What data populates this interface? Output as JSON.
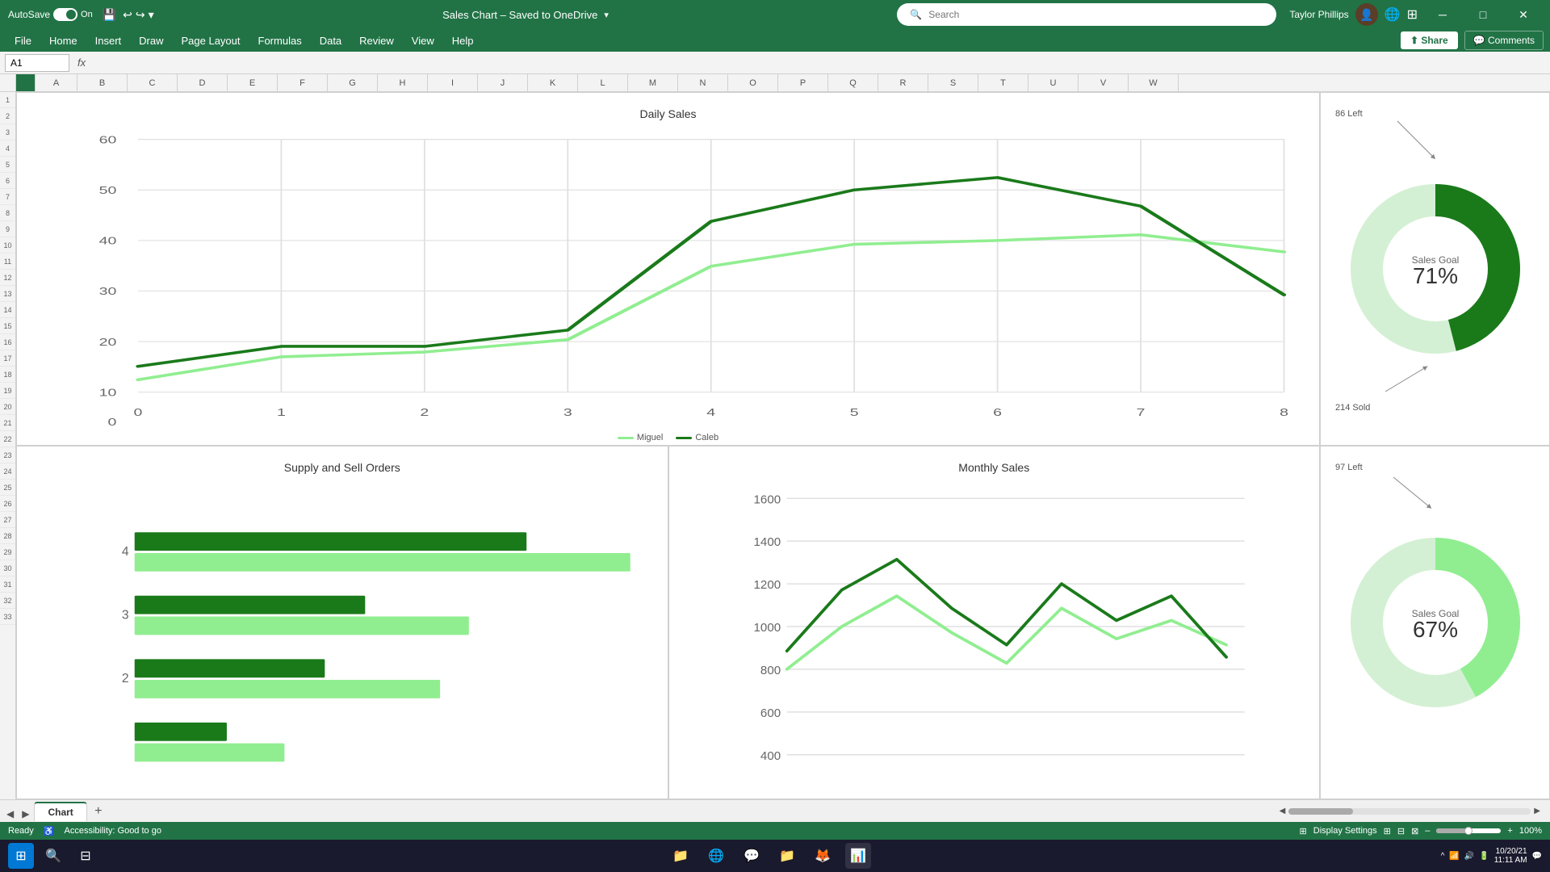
{
  "titlebar": {
    "autosave_label": "AutoSave",
    "toggle_state": "On",
    "file_title": "Sales Chart – Saved to OneDrive",
    "search_placeholder": "Search",
    "user_name": "Taylor Phillips",
    "undo_icon": "↩",
    "redo_icon": "↪"
  },
  "menubar": {
    "items": [
      "File",
      "Home",
      "Insert",
      "Draw",
      "Page Layout",
      "Formulas",
      "Data",
      "Review",
      "View",
      "Help"
    ],
    "share_label": "Share",
    "comments_label": "Comments"
  },
  "formulabar": {
    "cell_ref": "A1",
    "fx_label": "fx"
  },
  "columns": [
    "A",
    "B",
    "C",
    "D",
    "E",
    "F",
    "G",
    "H",
    "I",
    "J",
    "K",
    "L",
    "M",
    "N",
    "O",
    "P",
    "Q",
    "R",
    "S",
    "T",
    "U",
    "V",
    "W"
  ],
  "charts": {
    "daily_sales": {
      "title": "Daily Sales",
      "x_labels": [
        "0",
        "1",
        "2",
        "3",
        "4",
        "5",
        "6",
        "7",
        "8"
      ],
      "y_labels": [
        "0",
        "10",
        "20",
        "30",
        "40",
        "50",
        "60"
      ],
      "series": [
        {
          "name": "Miguel",
          "color": "#90ee90"
        },
        {
          "name": "Caleb",
          "color": "#1a7a1a"
        }
      ]
    },
    "supply_sell": {
      "title": "Supply and Sell Orders",
      "bars": [
        {
          "label": "4",
          "dark": 350,
          "light": 430
        },
        {
          "label": "3",
          "dark": 200,
          "light": 290
        },
        {
          "label": "2",
          "dark": 175,
          "light": 270
        }
      ]
    },
    "monthly_sales": {
      "title": "Monthly Sales",
      "y_labels": [
        "400",
        "600",
        "800",
        "1000",
        "1200",
        "1400",
        "1600"
      ]
    },
    "donut1": {
      "left_label": "86 Left",
      "bottom_label": "214 Sold",
      "goal_label": "Sales Goal",
      "percentage": "71%",
      "pct_value": 71,
      "color_filled": "#1a7a1a",
      "color_empty": "#d4f0d4"
    },
    "donut2": {
      "left_label": "97 Left",
      "bottom_label": "",
      "goal_label": "Sales Goal",
      "percentage": "67%",
      "pct_value": 67,
      "color_filled": "#90ee90",
      "color_empty": "#d4f0d4"
    }
  },
  "tabbar": {
    "sheets": [
      {
        "label": "Chart",
        "active": true
      }
    ],
    "add_label": "+"
  },
  "statusbar": {
    "ready_label": "Ready",
    "accessibility_label": "Accessibility: Good to go",
    "display_settings_label": "Display Settings",
    "zoom_level": "100%",
    "date": "10/20/21",
    "time": "11:11 AM"
  },
  "taskbar": {
    "items": [
      "⊞",
      "🔍",
      "📁",
      "🌐",
      "💬",
      "📁",
      "🦊",
      "📊",
      "⬡"
    ],
    "sys_icons": [
      "🔊",
      "📶",
      "🔋"
    ]
  }
}
